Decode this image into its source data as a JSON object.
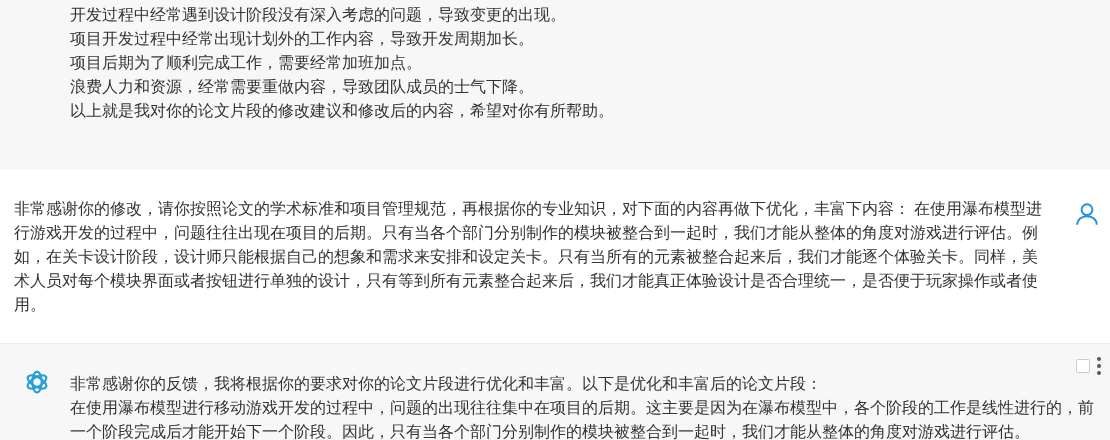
{
  "messages": [
    {
      "kind": "assistant",
      "show_avatar": false,
      "lines": [
        "开发过程中经常遇到设计阶段没有深入考虑的问题，导致变更的出现。",
        "项目开发过程中经常出现计划外的工作内容，导致开发周期加长。",
        "项目后期为了顺利完成工作，需要经常加班加点。",
        "浪费人力和资源，经常需要重做内容，导致团队成员的士气下降。",
        "以上就是我对你的论文片段的修改建议和修改后的内容，希望对你有所帮助。"
      ]
    },
    {
      "kind": "user",
      "lines": [
        "非常感谢你的修改，请你按照论文的学术标准和项目管理规范，再根据你的专业知识，对下面的内容再做下优化，丰富下内容： 在使用瀑布模型进行游戏开发的过程中，问题往往出现在项目的后期。只有当各个部门分别制作的模块被整合到一起时，我们才能从整体的角度对游戏进行评估。例如，在关卡设计阶段，设计师只能根据自己的想象和需求来安排和设定关卡。只有当所有的元素被整合起来后，我们才能逐个体验关卡。同样，美术人员对每个模块界面或者按钮进行单独的设计，只有等到所有元素整合起来后，我们才能真正体验设计是否合理统一，是否便于玩家操作或者使用。"
      ]
    },
    {
      "kind": "assistant",
      "show_avatar": true,
      "checked": false,
      "lines": [
        "非常感谢你的反馈，我将根据你的要求对你的论文片段进行优化和丰富。以下是优化和丰富后的论文片段：",
        "在使用瀑布模型进行移动游戏开发的过程中，问题的出现往往集中在项目的后期。这主要是因为在瀑布模型中，各个阶段的工作是线性进行的，前一个阶段完成后才能开始下一个阶段。因此，只有当各个部门分别制作的模块被整合到一起时，我们才能从整体的角度对游戏进行评估。"
      ]
    }
  ]
}
